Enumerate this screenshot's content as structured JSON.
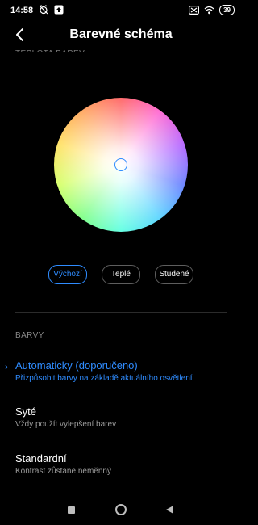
{
  "status_bar": {
    "time": "14:58",
    "battery": "39"
  },
  "header": {
    "title": "Barevné schéma",
    "back_icon": "chevron-left-icon"
  },
  "cut_section_label": "TEPLOTA BAREV",
  "temperature_buttons": [
    {
      "label": "Výchozí",
      "active": true
    },
    {
      "label": "Teplé",
      "active": false
    },
    {
      "label": "Studené",
      "active": false
    }
  ],
  "colors_section": {
    "label": "BARVY",
    "options": [
      {
        "title": "Automaticky (doporučeno)",
        "subtitle": "Přizpůsobit barvy na základě aktuálního osvětlení",
        "selected": true
      },
      {
        "title": "Syté",
        "subtitle": "Vždy použít vylepšení barev",
        "selected": false
      },
      {
        "title": "Standardní",
        "subtitle": "Kontrast zůstane neměnný",
        "selected": false
      }
    ]
  },
  "theme": {
    "accent": "#2f8cff",
    "background": "#000000"
  }
}
